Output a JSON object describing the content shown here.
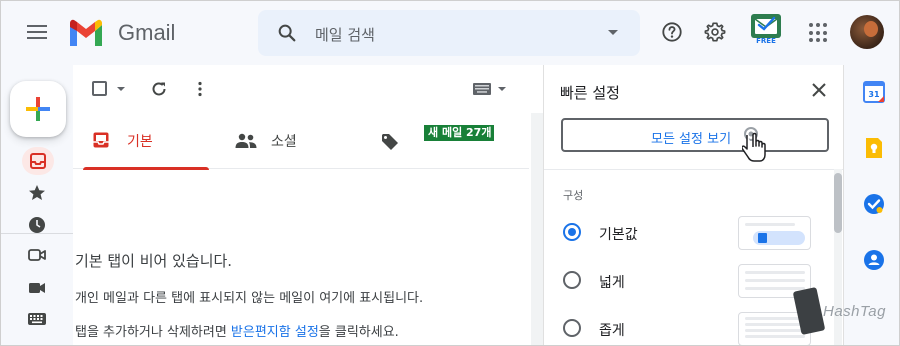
{
  "header": {
    "brand": "Gmail",
    "search_placeholder": "메일 검색",
    "extension_badge": "FREE"
  },
  "toolbar": {
    "new_badge": "새 메일 27개"
  },
  "tabs": [
    {
      "label": "기본"
    },
    {
      "label": "소셜"
    },
    {
      "label": ""
    }
  ],
  "empty_state": {
    "title": "기본 탭이 비어 있습니다.",
    "line1": "개인 메일과 다른 탭에 표시되지 않는 메일이 여기에 표시됩니다.",
    "line2_pre": "탭을 추가하거나 삭제하려면 ",
    "line2_link": "받은편지함 설정",
    "line2_post": "을 클릭하세요."
  },
  "quick_settings": {
    "title": "빠른 설정",
    "all_settings_button": "모든 설정 보기",
    "section_density": "구성",
    "options": [
      {
        "label": "기본값",
        "selected": true
      },
      {
        "label": "넓게",
        "selected": false
      },
      {
        "label": "좁게",
        "selected": false
      }
    ]
  },
  "watermark": "HashTag",
  "colors": {
    "accent_red": "#d93025",
    "link_blue": "#1a73e8",
    "badge_green": "#188038",
    "search_bg": "#eaf1fb"
  }
}
